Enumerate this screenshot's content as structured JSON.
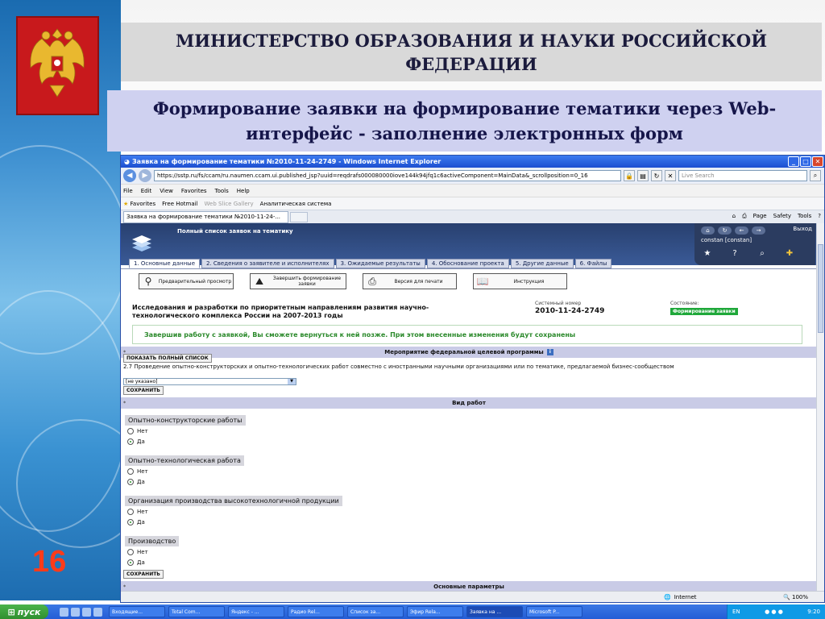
{
  "slide": {
    "ministry_title": "МИНИСТЕРСТВО ОБРАЗОВАНИЯ И НАУКИ РОССИЙСКОЙ ФЕДЕРАЦИИ",
    "topic_title": "Формирование заявки на формирование тематики через Web-интерфейс - заполнение электронных форм",
    "slide_number": "16"
  },
  "browser": {
    "window_title": "Заявка на формирование тематики №2010-11-24-2749 - Windows Internet Explorer",
    "address": "https://sstp.ru/fs/ccam/ru.naumen.ccam.ui.published_jsp?uuid=reqdrafs000080000iove144k94jfq1c6activeComponent=MainData&_scrollposition=0_16",
    "search_placeholder": "Live Search",
    "menu": [
      "File",
      "Edit",
      "View",
      "Favorites",
      "Tools",
      "Help"
    ],
    "favorites": [
      "Favorites",
      "Free Hotmail",
      "Web Slice Gallery",
      "Аналитическая система"
    ],
    "tab_title": "Заявка на формирование тематики №2010-11-24-...",
    "commands": [
      "Page",
      "Safety",
      "Tools"
    ],
    "status_zone": "Internet",
    "zoom": "100%"
  },
  "app": {
    "header_title": "Полный список заявок на тематику",
    "logout": "Выход",
    "username": "constan [constan]",
    "tabs": [
      "1. Основные данные",
      "2. Сведения о заявителе и исполнителях",
      "3. Ожидаемые результаты",
      "4. Обоснование проекта",
      "5. Другие данные",
      "6. Файлы"
    ],
    "actions": {
      "preview": "Предварительный просмотр",
      "finish": "Завершить формирование заявки",
      "print": "Версия для печати",
      "manual": "Инструкция"
    },
    "request_name": "Исследования и разработки по приоритетным направлениям развития научно-технологического комплекса России на 2007-2013 годы",
    "system_number_label": "Системный номер",
    "system_number": "2010-11-24-2749",
    "state_label": "Состояние:",
    "state_value": "Формирование заявки",
    "notice": "Завершив работу с заявкой, Вы сможете вернуться к ней позже. При этом внесенные изменения будут сохранены",
    "section1": "Мероприятие федеральной целевой программы",
    "show_full_list": "ПОКАЗАТЬ ПОЛНЫЙ СПИСОК",
    "program_text": "2.7 Проведение опытно-конструкторских и опытно-технологических работ совместно с иностранными научными организациями или по тематике, предлагаемой бизнес-сообществом",
    "select_value": "[не указано]",
    "save": "СОХРАНИТЬ",
    "section2": "Вид работ",
    "groups": [
      {
        "label": "Опытно-конструкторские работы",
        "no": "Нет",
        "yes": "Да"
      },
      {
        "label": "Опытно-технологическая работа",
        "no": "Нет",
        "yes": "Да"
      },
      {
        "label": "Организация производства высокотехнологичной продукции",
        "no": "Нет",
        "yes": "Да"
      },
      {
        "label": "Производство",
        "no": "Нет",
        "yes": "Да"
      }
    ],
    "section3": "Основные параметры"
  },
  "taskbar": {
    "start": "пуск",
    "tasks": [
      "Входящие...",
      "Total Com...",
      "Яндекс - ...",
      "Радио Rel...",
      "Список за...",
      "Эфир Rela...",
      "Заявка на ...",
      "Microsoft P..."
    ],
    "lang": "EN",
    "time": "9:20"
  },
  "colors": {
    "accent": "#1c4bb5",
    "state_green": "#1fa83a",
    "notice_green": "#2c8a2c",
    "section_bar": "#c9cbe6",
    "slide_number": "#ff3b1a"
  }
}
